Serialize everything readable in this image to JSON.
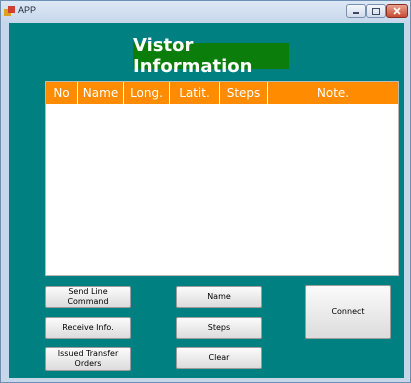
{
  "window": {
    "title": "APP"
  },
  "header": {
    "title": "Vistor Information"
  },
  "table": {
    "columns": [
      "No",
      "Name",
      "Long.",
      "Latit.",
      "Steps",
      "Note."
    ],
    "rows": []
  },
  "buttons": {
    "send_line_command": "Send Line Command",
    "receive_info": "Receive Info.",
    "issued_transfer_orders": "Issued Transfer Orders",
    "name": "Name",
    "steps": "Steps",
    "clear": "Clear",
    "connect": "Connect"
  },
  "colors": {
    "client_background": "#008080",
    "header_background": "#0b7d0b",
    "table_header": "#ff8c00"
  }
}
